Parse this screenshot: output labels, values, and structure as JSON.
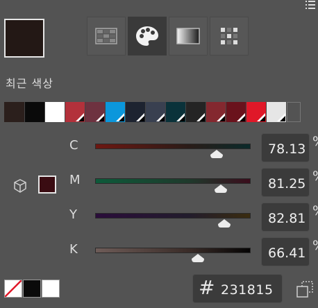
{
  "panel": {
    "recent_label": "최근 색상",
    "current_color": "#231815"
  },
  "modes": [
    {
      "name": "swatch-grid-icon",
      "active": false
    },
    {
      "name": "palette-icon",
      "active": true
    },
    {
      "name": "gradient-icon",
      "active": false
    },
    {
      "name": "pattern-icon",
      "active": false
    }
  ],
  "recent_colors": [
    "#2b1f1c",
    "#0a0a0a",
    "#ffffff",
    "#b3313b",
    "#6e3240",
    "#0b97dc",
    "#1d2330",
    "#394050",
    "#0a323a",
    "#242424",
    "#84282f",
    "#6a121c",
    "#e01828",
    "#e6e6e6",
    "#5a5a5a"
  ],
  "sliders": [
    {
      "label": "C",
      "value": "78.13",
      "level": 0.78,
      "gradient": "linear-gradient(to right,#6d1711,#2a1c18 60%,#0b2a2a)"
    },
    {
      "label": "M",
      "value": "81.25",
      "level": 0.81,
      "gradient": "linear-gradient(to right,#0d5a3a,#1f3a2c 60%,#3a0d1c)"
    },
    {
      "label": "Y",
      "value": "82.81",
      "level": 0.83,
      "gradient": "linear-gradient(to right,#2a0d3a,#221c2c 60%,#3a2c10)"
    },
    {
      "label": "K",
      "value": "66.41",
      "level": 0.66,
      "gradient": "linear-gradient(to right,#6e5c58,#3a2c28 60%,#050404)"
    }
  ],
  "percent_sign": "%",
  "hex": {
    "hash": "#",
    "value": "231815"
  },
  "bottom_swatches": [
    "none",
    "#0a0a0a",
    "#ffffff"
  ]
}
